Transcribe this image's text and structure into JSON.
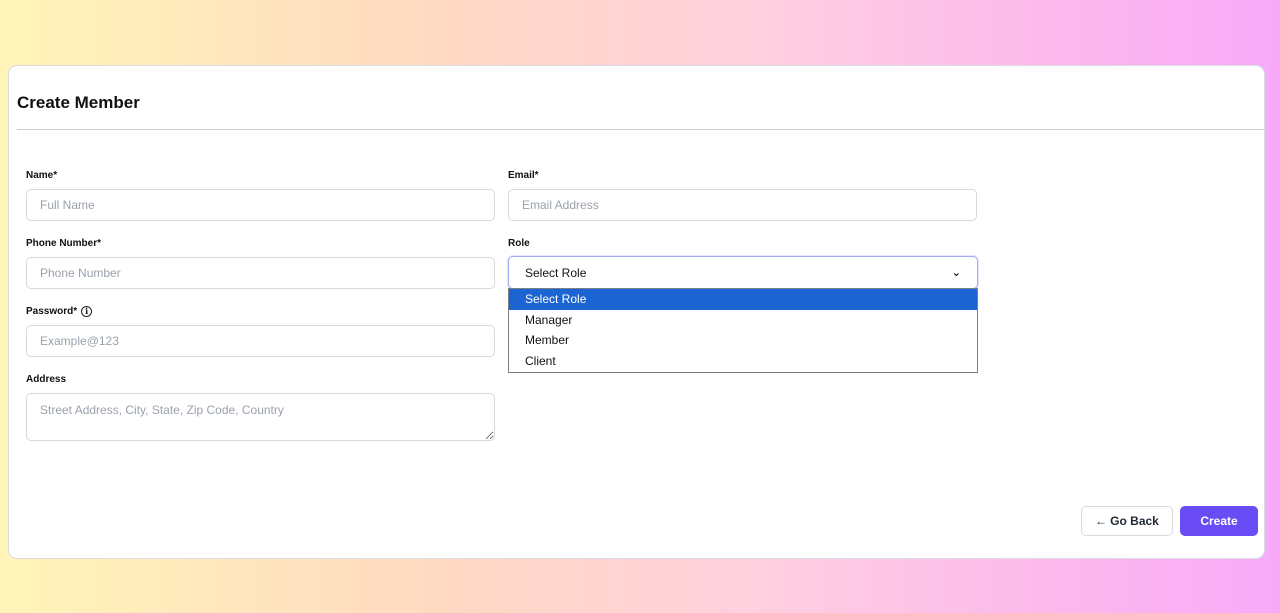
{
  "page": {
    "title": "Create Member"
  },
  "form": {
    "name": {
      "label": "Name*",
      "placeholder": "Full Name",
      "value": ""
    },
    "email": {
      "label": "Email*",
      "placeholder": "Email Address",
      "value": ""
    },
    "phone": {
      "label": "Phone Number*",
      "placeholder": "Phone Number",
      "value": ""
    },
    "role": {
      "label": "Role",
      "selected": "Select Role",
      "options": [
        "Select Role",
        "Manager",
        "Member",
        "Client"
      ]
    },
    "password": {
      "label": "Password*",
      "placeholder": "Example@123",
      "value": "",
      "info_icon": "info-circle-icon"
    },
    "address": {
      "label": "Address",
      "placeholder": "Street Address, City, State, Zip Code, Country",
      "value": ""
    }
  },
  "actions": {
    "back_arrow": "←",
    "back_label": "Go Back",
    "create_label": "Create"
  },
  "colors": {
    "accent": "#6a4cf5",
    "option_highlight": "#1c64d1",
    "select_focus_border": "#a5aaf3"
  }
}
